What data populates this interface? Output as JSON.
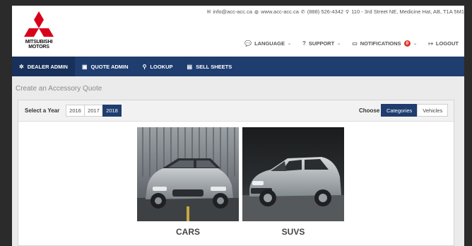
{
  "brand": {
    "logo_line1": "MITSUBISHI",
    "logo_line2": "MOTORS",
    "red": "#d9001b"
  },
  "contact": {
    "email": "info@acc-acc.ca",
    "website": "www.acc-acc.ca",
    "phone": "(888) 526-4342",
    "address": "110 - 3rd Street NE, Medicine Hat, AB, T1A 5M1"
  },
  "utility_nav": {
    "language": "LANGUAGE",
    "support": "SUPPORT",
    "notifications": "NOTIFICATIONS",
    "notifications_count": "0",
    "logout": "LOGOUT"
  },
  "main_nav": {
    "items": [
      {
        "label": "DEALER ADMIN",
        "icon": "gear-icon"
      },
      {
        "label": "QUOTE ADMIN",
        "icon": "quote-icon"
      },
      {
        "label": "LOOKUP",
        "icon": "search-icon"
      },
      {
        "label": "SELL SHEETS",
        "icon": "document-icon"
      }
    ],
    "bg_color": "#1f3d6e"
  },
  "page": {
    "title": "Create an Accessory Quote"
  },
  "filters": {
    "year_label": "Select a Year",
    "years": [
      "2016",
      "2017",
      "2018"
    ],
    "selected_year": "2018",
    "choose_label": "Choose",
    "choose_options": [
      "Categories",
      "Vehicles"
    ],
    "selected_choose": "Categories"
  },
  "categories": [
    {
      "label": "CARS",
      "image": "silver hatchback car"
    },
    {
      "label": "SUVS",
      "image": "silver SUV"
    }
  ]
}
